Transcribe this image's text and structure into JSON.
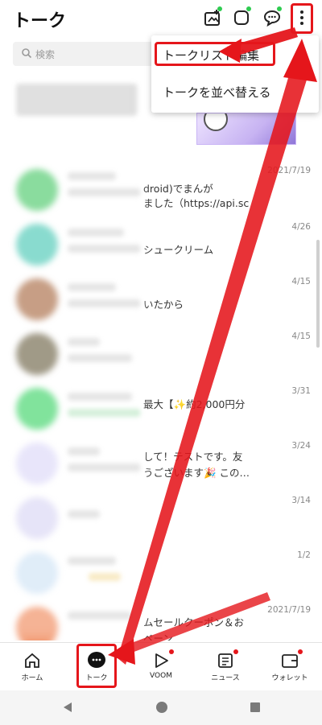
{
  "header": {
    "title": "トーク"
  },
  "search": {
    "placeholder": "検索"
  },
  "menu": {
    "items": [
      "トークリスト編集",
      "トークを並べ替える"
    ]
  },
  "chats": [
    {
      "preview": "",
      "date": ""
    },
    {
      "preview": "droid)でまんが\nました（https://api.sc",
      "date": "2021/7/19"
    },
    {
      "preview": "シュークリーム",
      "date": "4/26"
    },
    {
      "preview": "いたから",
      "date": "4/15"
    },
    {
      "preview": "",
      "date": "4/15"
    },
    {
      "preview": "最大【✨約2,000円分",
      "date": "3/31"
    },
    {
      "preview": "して！テストです。友\nうございます🎉 この…",
      "date": "3/24"
    },
    {
      "preview": "",
      "date": "3/14"
    },
    {
      "preview": "",
      "date": "1/2"
    },
    {
      "preview": "ムセールクーポン＆お\nペーン",
      "date": "2021/7/19"
    }
  ],
  "nav": [
    {
      "label": "ホーム",
      "icon": "home-icon"
    },
    {
      "label": "トーク",
      "icon": "talk-icon"
    },
    {
      "label": "VOOM",
      "icon": "voom-icon"
    },
    {
      "label": "ニュース",
      "icon": "news-icon"
    },
    {
      "label": "ウォレット",
      "icon": "wallet-icon"
    }
  ],
  "colors": {
    "highlight": "#e5161b",
    "badge_green": "#2ecc50",
    "badge_red": "#e5161b"
  }
}
